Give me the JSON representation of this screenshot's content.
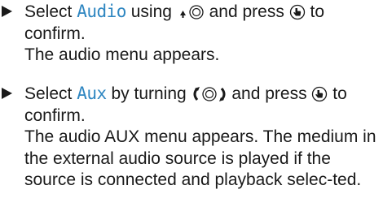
{
  "steps": [
    {
      "pre": "Select ",
      "highlight": "Audio",
      "mid": " using ",
      "mid2": " and press ",
      "post": " to confirm.",
      "result": "The audio menu appears."
    },
    {
      "pre": "Select ",
      "highlight": "Aux",
      "mid": " by turning ",
      "mid2": " and press ",
      "post": " to confirm.",
      "result": "The audio AUX menu appears. The medium in the external audio source is played if the source is connected and playback selec-ted."
    }
  ],
  "colors": {
    "highlight": "#2e86c1",
    "text": "#1a1a1a"
  },
  "icons": {
    "slide_up_controller": "arrow-up-controller-icon",
    "turn_controller": "turn-controller-icon",
    "press_controller": "press-controller-icon"
  }
}
